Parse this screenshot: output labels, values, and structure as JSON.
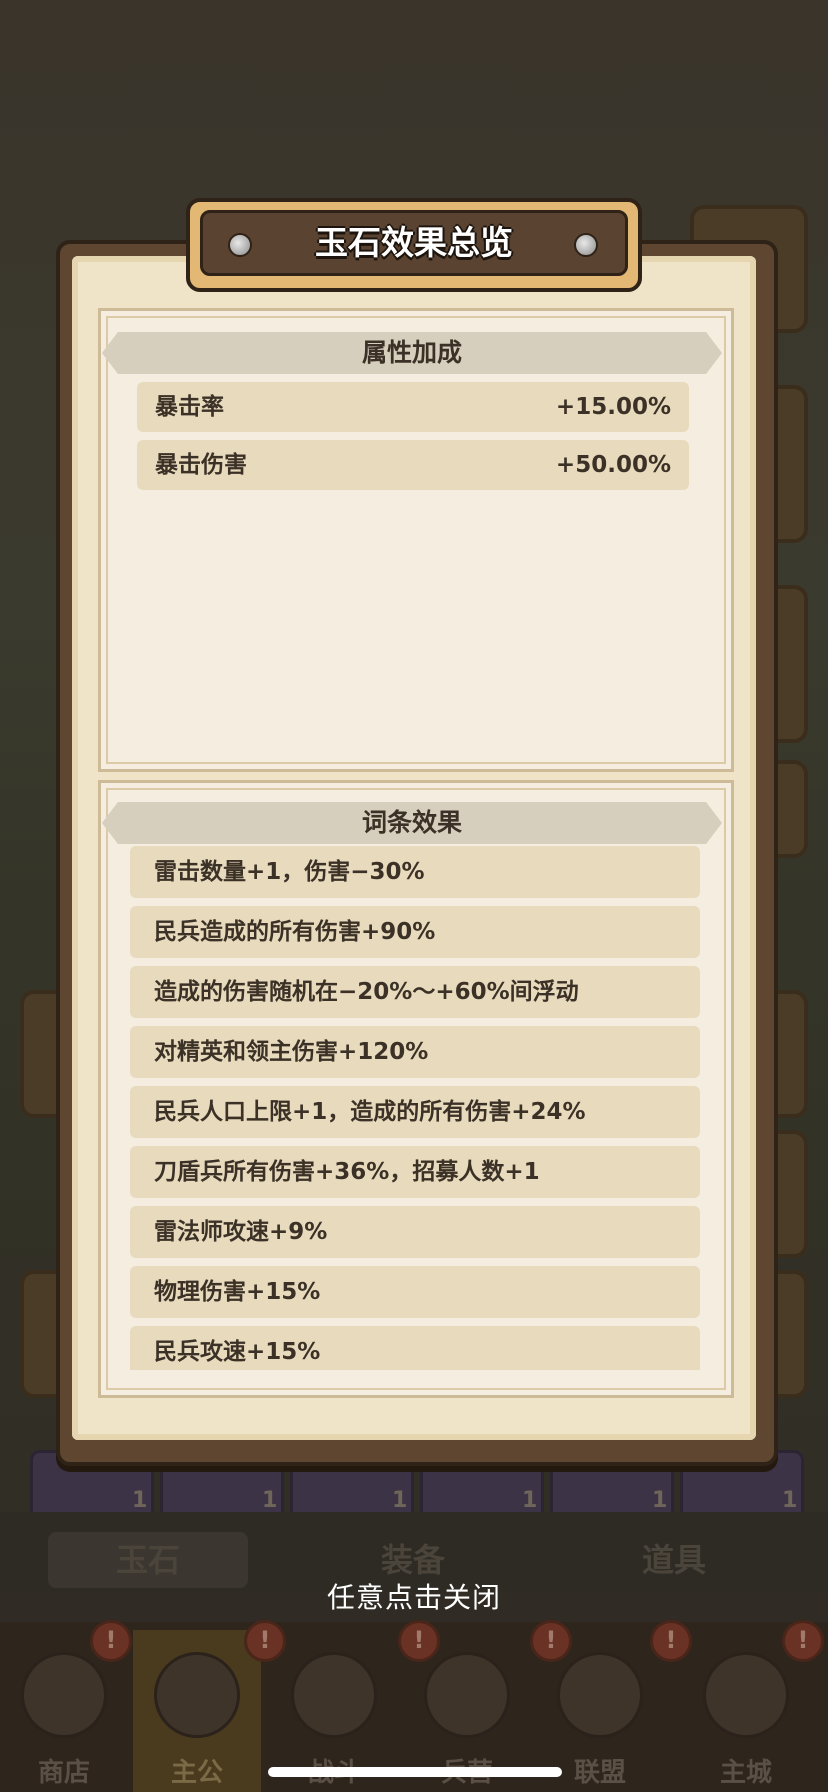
{
  "dialog": {
    "title": "玉石效果总览",
    "attributes": {
      "header": "属性加成",
      "items": [
        {
          "name": "暴击率",
          "value": "+15.00%"
        },
        {
          "name": "暴击伤害",
          "value": "+50.00%"
        }
      ]
    },
    "affixes": {
      "header": "词条效果",
      "items": [
        "雷击数量+1，伤害−30%",
        "民兵造成的所有伤害+90%",
        "造成的伤害随机在−20%～+60%间浮动",
        "对精英和领主伤害+120%",
        "民兵人口上限+1，造成的所有伤害+24%",
        "刀盾兵所有伤害+36%，招募人数+1",
        "雷法师攻速+9%",
        "物理伤害+15%",
        "民兵攻速+15%"
      ]
    },
    "close_hint": "任意点击关闭"
  },
  "background": {
    "tabs": [
      "玉石",
      "装备",
      "道具"
    ],
    "nav": [
      "商店",
      "主公",
      "战斗",
      "兵营",
      "联盟",
      "主城"
    ],
    "alert_mark": "!",
    "counts": [
      "1",
      "1",
      "1",
      "1",
      "1",
      "1"
    ]
  }
}
